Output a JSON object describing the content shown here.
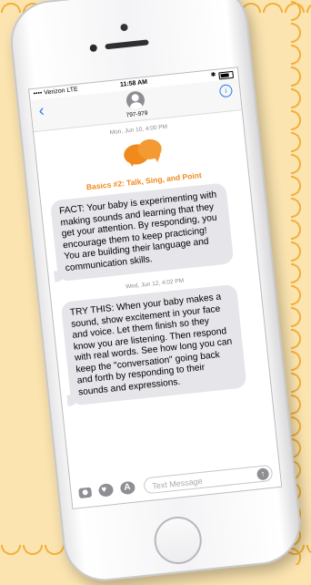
{
  "status_bar": {
    "carrier": "•••• Verizon  LTE",
    "time": "11:58 AM"
  },
  "navbar": {
    "back": "‹",
    "contact_number": "797-979",
    "info": "i"
  },
  "thread": {
    "timestamp_1": "Mon, Jun 10, 4:00 PM",
    "series_title": "Basics #2: Talk, Sing, and Point",
    "message_1": "FACT: Your baby is experimenting with making sounds and learning that they get your attention. By responding, you encourage them to keep practicing! You are building their language and communication skills.",
    "timestamp_2": "Wed, Jun 12, 4:02 PM",
    "message_2": "TRY THIS: When your baby makes a sound, show excitement in your face and voice. Let them finish so they know you are listening. Then respond with real words. See how long you can keep the \"conversation\" going back and forth by responding to their sounds and expressions."
  },
  "compose": {
    "placeholder": "Text Message",
    "send_icon": "↑"
  },
  "colors": {
    "accent": "#f08a1c",
    "ios_blue": "#1a7bf0",
    "bubble": "#e5e5ea",
    "background": "#fbe4b0"
  }
}
